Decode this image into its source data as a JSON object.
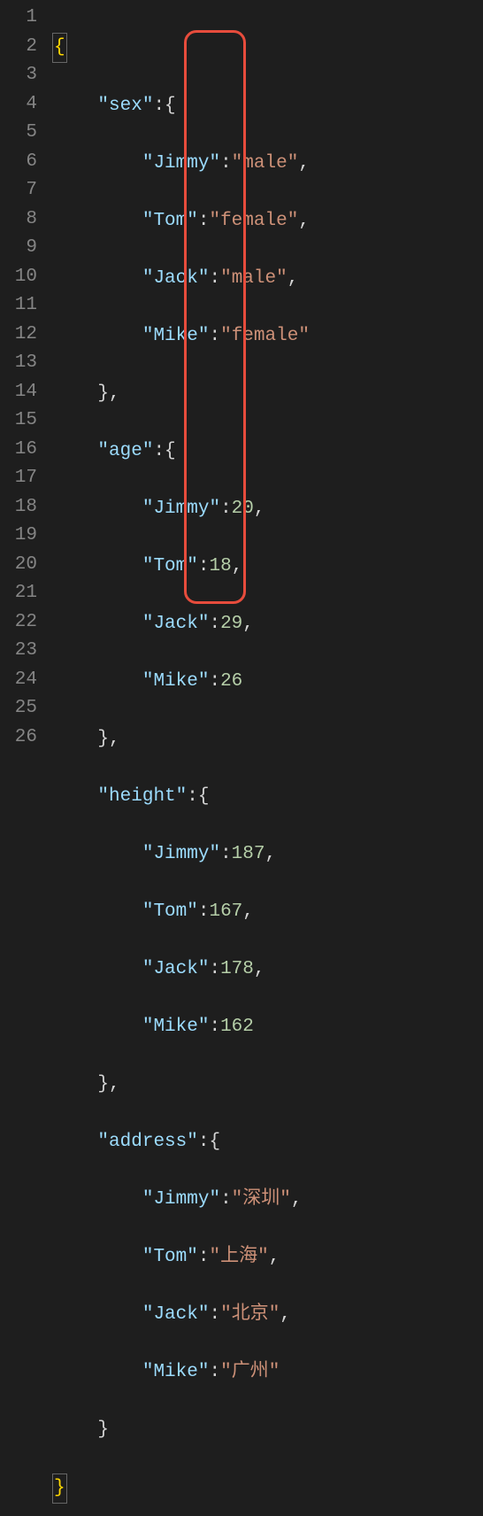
{
  "code": {
    "keys": {
      "sex": "sex",
      "age": "age",
      "height": "height",
      "address": "address",
      "jimmy": "Jimmy",
      "tom": "Tom",
      "jack": "Jack",
      "mike": "Mike"
    },
    "values": {
      "sex_jimmy": "male",
      "sex_tom": "female",
      "sex_jack": "male",
      "sex_mike": "female",
      "age_jimmy": "20",
      "age_tom": "18",
      "age_jack": "29",
      "age_mike": "26",
      "height_jimmy": "187",
      "height_tom": "167",
      "height_jack": "178",
      "height_mike": "162",
      "address_jimmy": "深圳",
      "address_tom": "上海",
      "address_jack": "北京",
      "address_mike": "广州"
    }
  },
  "lineNumbers": {
    "l1": "1",
    "l2": "2",
    "l3": "3",
    "l4": "4",
    "l5": "5",
    "l6": "6",
    "l7": "7",
    "l8": "8",
    "l9": "9",
    "l10": "10",
    "l11": "11",
    "l12": "12",
    "l13": "13",
    "l14": "14",
    "l15": "15",
    "l16": "16",
    "l17": "17",
    "l18": "18",
    "l19": "19",
    "l20": "20",
    "l21": "21",
    "l22": "22",
    "l23": "23",
    "l24": "24",
    "l25": "25",
    "l26": "26"
  },
  "q": "\""
}
